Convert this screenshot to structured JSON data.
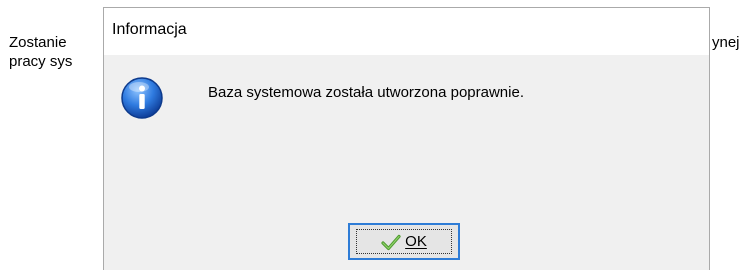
{
  "background": {
    "line1_left": "Zostanie",
    "line2_left": "pracy sys",
    "line1_right": "ynej"
  },
  "dialog": {
    "title": "Informacja",
    "icon": "info-icon",
    "message": "Baza systemowa została utworzona poprawnie.",
    "ok_button": {
      "label": "OK",
      "icon": "checkmark-icon"
    }
  },
  "colors": {
    "dialog_body": "#f0f0f0",
    "titlebar": "#ffffff",
    "button_focus_border": "#2e7cd6",
    "icon_blue": "#1f64c8",
    "check_green": "#5aa83c"
  }
}
